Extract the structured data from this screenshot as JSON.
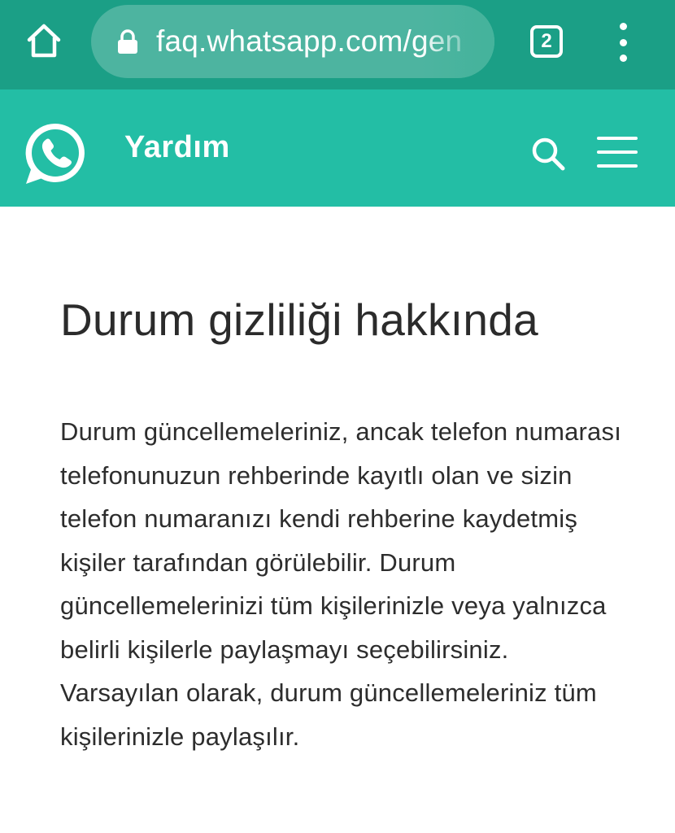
{
  "browser": {
    "url": "faq.whatsapp.com/gen",
    "tab_count": "2",
    "icons": {
      "home": "home-icon",
      "lock": "lock-icon",
      "menu": "more-vert-icon"
    },
    "bar_color": "#1b9f86"
  },
  "header": {
    "title": "Yardım",
    "color": "#23bea5",
    "icons": {
      "logo": "whatsapp-logo-icon",
      "search": "search-icon",
      "menu": "hamburger-menu-icon"
    }
  },
  "article": {
    "title": "Durum gizliliği hakkında",
    "body": "Durum güncellemeleriniz, ancak telefon numarası telefonunuzun rehberinde kayıtlı olan ve sizin telefon numaranızı kendi rehberine kaydetmiş kişiler tarafından görülebilir. Durum güncellemelerinizi tüm kişilerinizle veya yalnızca belirli kişilerle paylaşmayı seçebilirsiniz. Varsayılan olarak, durum güncellemeleriniz tüm kişilerinizle paylaşılır."
  }
}
